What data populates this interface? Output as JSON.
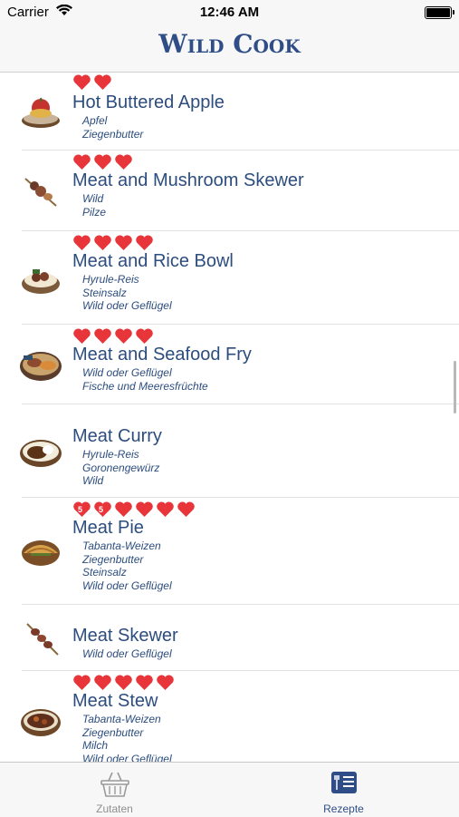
{
  "status": {
    "carrier": "Carrier",
    "time": "12:46 AM"
  },
  "app": {
    "title": "Wild Cook"
  },
  "recipes": [
    {
      "name": "Hot Buttered Apple",
      "hearts": 2,
      "ingredients": [
        "Apfel",
        "Ziegenbutter"
      ]
    },
    {
      "name": "Meat and Mushroom Skewer",
      "hearts": 3,
      "ingredients": [
        "Wild",
        "Pilze"
      ]
    },
    {
      "name": "Meat and Rice Bowl",
      "hearts": 4,
      "ingredients": [
        "Hyrule-Reis",
        "Steinsalz",
        "Wild oder Geflügel"
      ]
    },
    {
      "name": "Meat and Seafood Fry",
      "hearts": 4,
      "ingredients": [
        "Wild oder Geflügel",
        "Fische und Meeresfrüchte"
      ]
    },
    {
      "name": "Meat Curry",
      "hearts": 0,
      "ingredients": [
        "Hyrule-Reis",
        "Goronengewürz",
        "Wild"
      ]
    },
    {
      "name": "Meat Pie",
      "hearts": 6,
      "heart_badges": [
        "5",
        "5"
      ],
      "ingredients": [
        "Tabanta-Weizen",
        "Ziegenbutter",
        "Steinsalz",
        "Wild oder Geflügel"
      ]
    },
    {
      "name": "Meat Skewer",
      "hearts": 0,
      "ingredients": [
        "Wild oder Geflügel"
      ]
    },
    {
      "name": "Meat Stew",
      "hearts": 5,
      "ingredients": [
        "Tabanta-Weizen",
        "Ziegenbutter",
        "Milch",
        "Wild oder Geflügel"
      ]
    }
  ],
  "tabs": [
    {
      "label": "Zutaten",
      "icon": "basket-icon",
      "active": false
    },
    {
      "label": "Rezepte",
      "icon": "recipe-book-icon",
      "active": true
    }
  ],
  "colors": {
    "accent": "#2f4d86",
    "heart": "#e8353a",
    "text": "#2c4d7e"
  }
}
